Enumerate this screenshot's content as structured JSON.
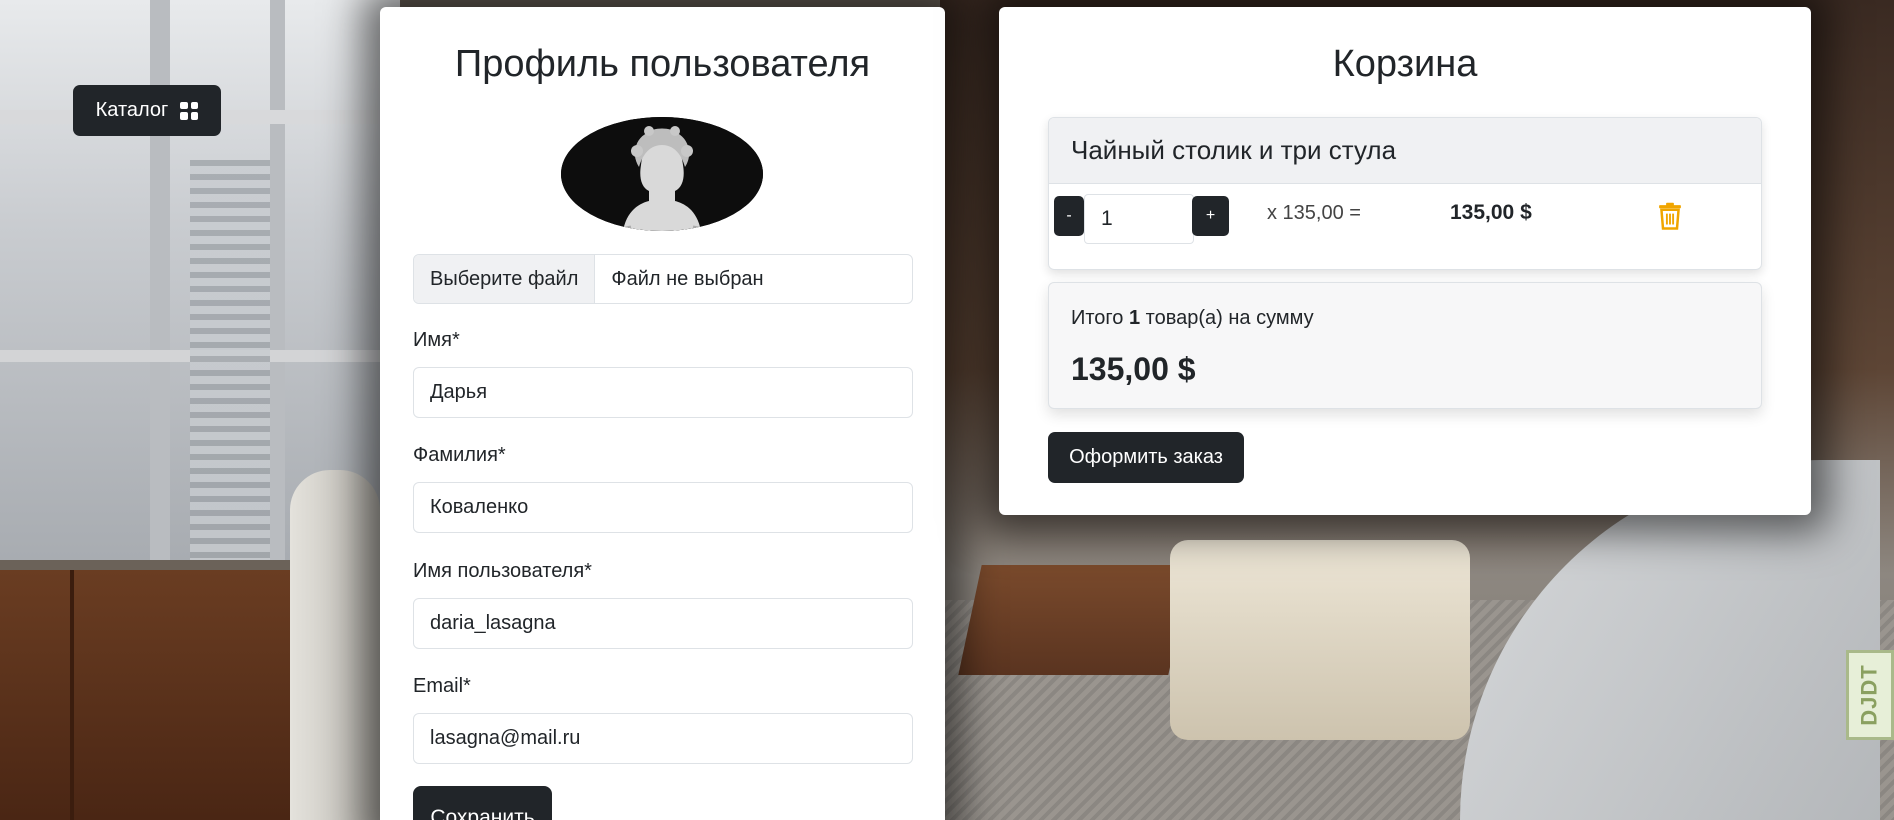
{
  "nav": {
    "catalog_label": "Каталог"
  },
  "profile": {
    "title": "Профиль пользователя",
    "file_button": "Выберите файл",
    "file_status": "Файл не выбран",
    "fields": [
      {
        "label": "Имя*",
        "value": "Дарья"
      },
      {
        "label": "Фамилия*",
        "value": "Коваленко"
      },
      {
        "label": "Имя пользователя*",
        "value": "daria_lasagna"
      },
      {
        "label": "Email*",
        "value": "lasagna@mail.ru"
      }
    ],
    "save_label": "Сохранить"
  },
  "cart": {
    "title": "Корзина",
    "item": {
      "name": "Чайный столик и три стула",
      "minus": "-",
      "plus": "+",
      "quantity": "1",
      "price_each": "x 135,00 =",
      "line_total": "135,00 $"
    },
    "summary": {
      "prefix": "Итого ",
      "count": "1",
      "suffix": " товар(а) на сумму",
      "total": "135,00 $"
    },
    "order_label": "Оформить заказ"
  },
  "badge": {
    "djdt": "DJDT"
  },
  "colors": {
    "dark": "#212529",
    "trash": "#f0a500",
    "border": "#dee2e6"
  }
}
